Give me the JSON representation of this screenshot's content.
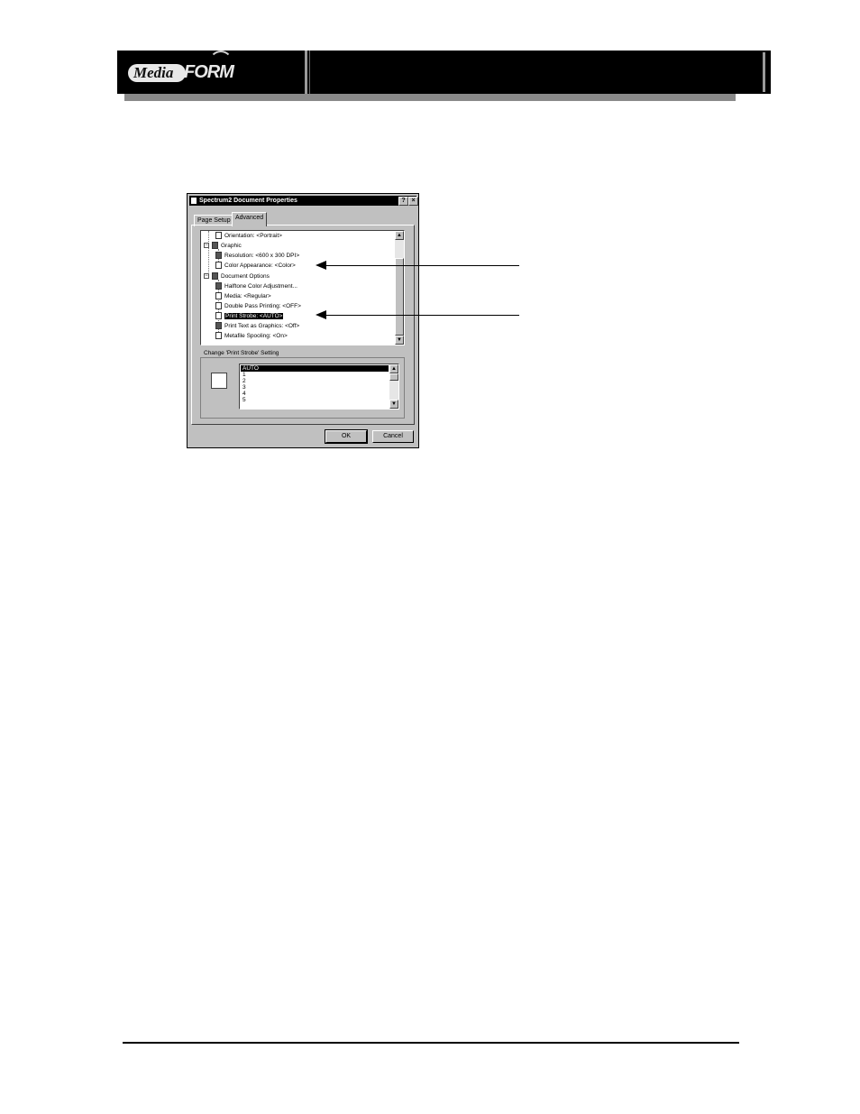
{
  "header": {
    "logo_media": "Media",
    "logo_form": "FORM"
  },
  "dialog": {
    "title": "Spectrum2 Document Properties",
    "help_button": "?",
    "close_button": "×",
    "tabs": [
      {
        "label": "Page Setup",
        "active": false
      },
      {
        "label": "Advanced",
        "active": true
      }
    ],
    "tree": [
      {
        "label": "Orientation: <Portrait>",
        "level": 2,
        "icon": "page-icon"
      },
      {
        "label": "Graphic",
        "level": 1,
        "icon": "graphic-icon",
        "expander": "−"
      },
      {
        "label": "Resolution: <600 x 300 DPI>",
        "level": 2,
        "icon": "resolution-icon"
      },
      {
        "label": "Color Appearance: <Color>",
        "level": 2,
        "icon": "color-icon"
      },
      {
        "label": "Document Options",
        "level": 1,
        "icon": "options-icon",
        "expander": "−"
      },
      {
        "label": "Halftone Color Adjustment...",
        "level": 2,
        "icon": "halftone-icon"
      },
      {
        "label": "Media: <Regular>",
        "level": 2,
        "icon": "media-icon"
      },
      {
        "label": "Double Pass Printing: <OFF>",
        "level": 2,
        "icon": "doublepass-icon"
      },
      {
        "label": "Print Strobe: <AUTO>",
        "level": 2,
        "icon": "strobe-icon",
        "selected": true
      },
      {
        "label": "Print Text as Graphics: <Off>",
        "level": 2,
        "icon": "text-graphics-icon"
      },
      {
        "label": "Metafile Spooling: <On>",
        "level": 2,
        "icon": "spool-icon"
      }
    ],
    "group_label": "Change 'Print Strobe' Setting",
    "strobe_options": [
      "AUTO",
      "1",
      "2",
      "3",
      "4",
      "5"
    ],
    "selected_option": "AUTO",
    "ok_label": "OK",
    "cancel_label": "Cancel"
  }
}
